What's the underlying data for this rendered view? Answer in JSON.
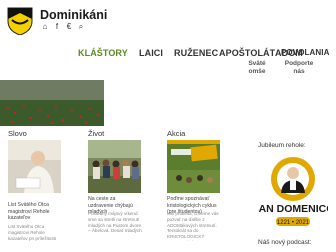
{
  "header": {
    "title": "Dominikáni",
    "icons": [
      "home-icon",
      "facebook-icon",
      "euro-icon",
      "search-icon"
    ],
    "icon_glyphs": [
      "⌂",
      "f",
      "€",
      "⌕"
    ]
  },
  "nav": {
    "items": [
      "KLÁŠTORY",
      "LAICI",
      "RUŽENEC",
      "APOŠTOLÁT",
      "ADOM",
      "POVOLANIA"
    ],
    "sub_items": [
      "Sväté omše",
      "Podporte nás"
    ]
  },
  "sections": {
    "slovo": {
      "label": "Slovo",
      "title": "List Svätého Otca magistrovi Rehole kazateľov",
      "text": "List Svätého Otca magistrovi Rehole kazateľov pri príležitosti"
    },
    "zivot": {
      "label": "Život",
      "title": "Na ceste za uzdravenie chýbajú mladých",
      "text": "Posledný májový víkend sme sa stretli na stretnutí mladých na Pustom dvore – Ábelová. Desať mladých"
    },
    "akcia": {
      "label": "Akcia",
      "title": "Poďme spoznávať kristologických cyklus (pre študentov)",
      "text": "Milí priatelia, chceme vás pozvať na ďalšie z ADOMákových stretnutí. Tentokrát sa do KRISTOLOGICKÝ CYKLUS, kde"
    }
  },
  "sidebar": {
    "jubilee_label": "Jubileum rehole:",
    "logo_text": "SAN DOMENICO",
    "logo_years": "1221 • 2021",
    "podcast_label": "Náš nový podcast:"
  },
  "colors": {
    "accent": "#5b8a1f",
    "gold": "#e0a800",
    "dark": "#1a1a1a"
  }
}
